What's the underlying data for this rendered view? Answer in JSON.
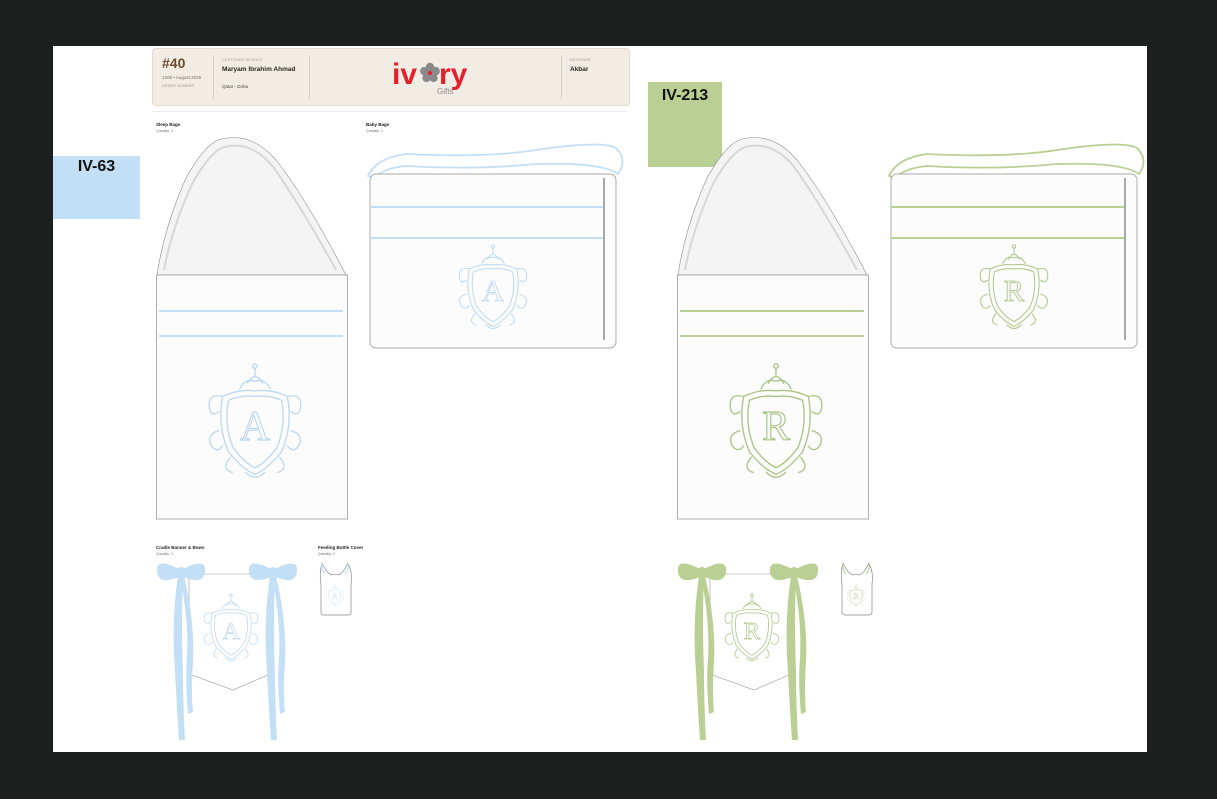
{
  "order": {
    "number": "#40",
    "date": "1208 • August 2026",
    "number_label": "ORDER NUMBER"
  },
  "customer": {
    "label": "CUSTOMER DETAILS",
    "name": "Maryam Ibrahim Ahmad",
    "location": "Qatar - Doha"
  },
  "designer": {
    "label": "DESIGNER",
    "name": "Akbar"
  },
  "brand": {
    "name": "ivory",
    "sub": "Gifts",
    "color": "#e4202c",
    "flower_color": "#8a8a8a"
  },
  "designs": [
    {
      "code": "IV-63",
      "monogram": "A",
      "color": "#bcd8f1",
      "line_color": "#c3dff6"
    },
    {
      "code": "IV-213",
      "monogram": "R",
      "color": "#a9c483",
      "line_color": "#b9cf93"
    }
  ],
  "sections": {
    "sleep_bags": {
      "title": "Sleep Bags",
      "quantity": "Quantity: 2"
    },
    "baby_bags": {
      "title": "Baby Bags",
      "quantity": "Quantity: 2"
    },
    "cradle": {
      "title": "Cradle Banner & Bows",
      "quantity": "Quantity: 2"
    },
    "bottle": {
      "title": "Feeding Bottle Cover",
      "quantity": "Quantity: 2"
    }
  },
  "icons": [
    "flower-logo-icon",
    "monogram-crest-icon",
    "bow-icon"
  ]
}
